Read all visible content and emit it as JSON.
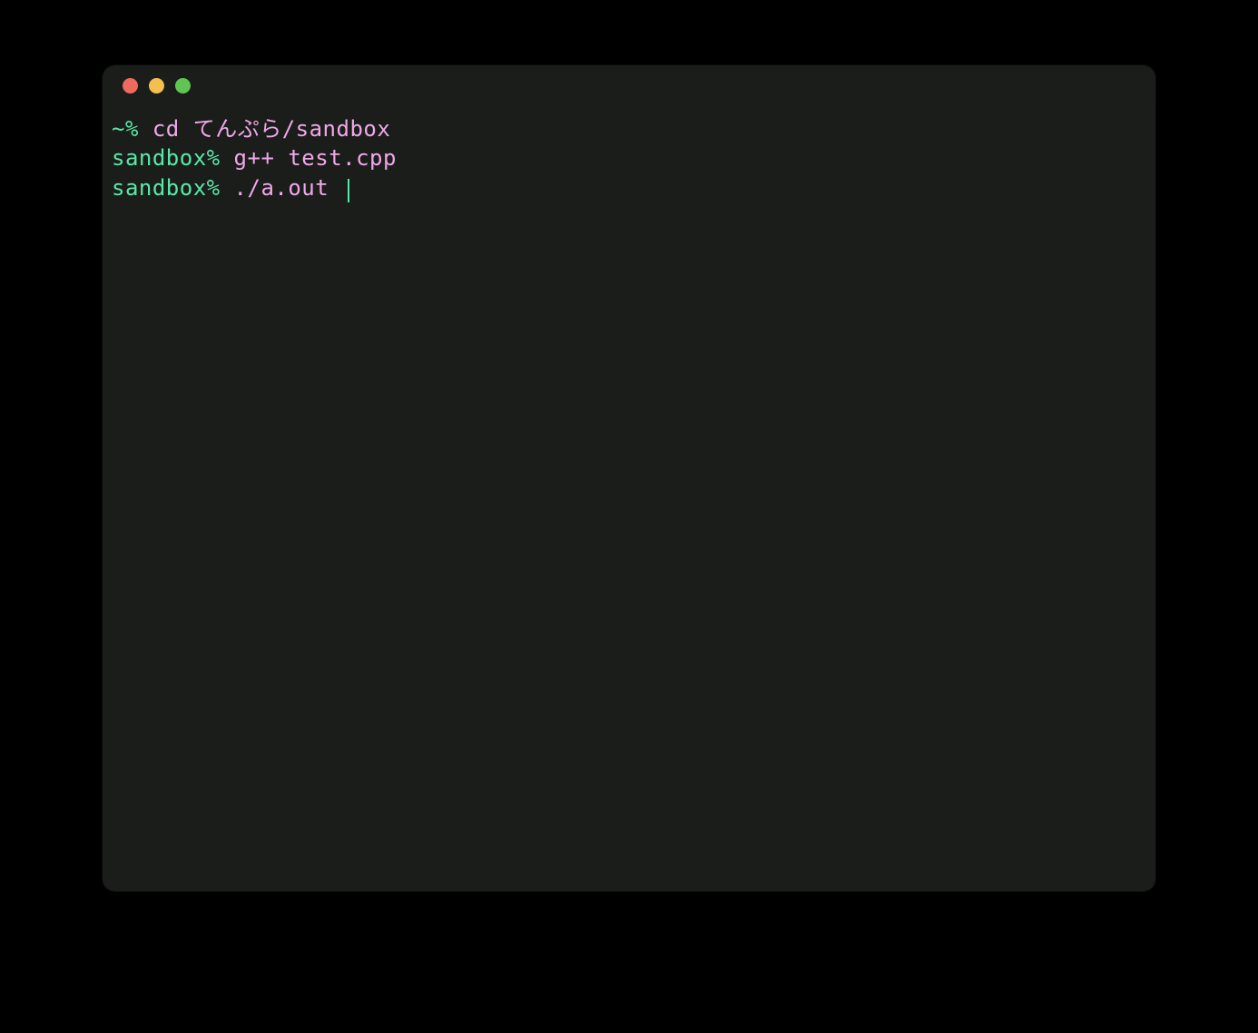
{
  "terminal": {
    "lines": [
      {
        "prompt": "~% ",
        "command": "cd てんぷら/sandbox"
      },
      {
        "prompt": "sandbox% ",
        "command": "g++ test.cpp"
      },
      {
        "prompt": "sandbox% ",
        "command": "./a.out "
      }
    ],
    "cursor_visible": true
  },
  "colors": {
    "background": "#000000",
    "terminal_bg": "#1a1d1a",
    "prompt": "#5ae8a8",
    "command": "#f0a8e8",
    "traffic_red": "#ed6a5e",
    "traffic_yellow": "#f4bf4f",
    "traffic_green": "#61c554"
  }
}
